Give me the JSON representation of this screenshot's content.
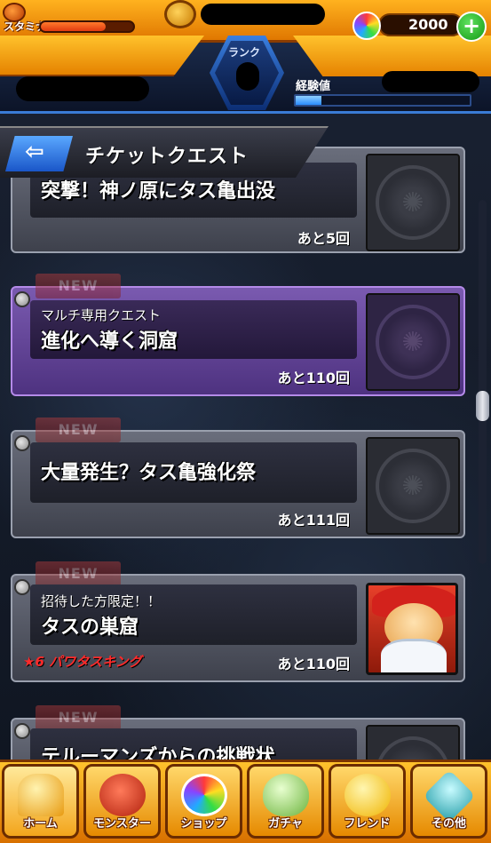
{
  "header": {
    "stamina_label": "スタミナ",
    "stamina_fill_fraction": 0.7,
    "orb_count": "2000",
    "add_orb_symbol": "+",
    "rank_label": "ランク",
    "exp_label": "経験値",
    "exp_fill_fraction": 0.15
  },
  "titlebar": {
    "back_symbol": "⇦",
    "title": "チケットクエスト"
  },
  "quests": [
    {
      "new_tag": "",
      "subtitle": "",
      "title": "突撃！神ノ原にタス亀出没",
      "remaining": "あと5回",
      "reward": "",
      "theme": "gray",
      "thumb": "dragon-emblem-icon"
    },
    {
      "new_tag": "NEW",
      "subtitle": "マルチ専用クエスト",
      "title": "進化へ導く洞窟",
      "remaining": "あと110回",
      "reward": "",
      "theme": "purple",
      "thumb": "dragon-emblem-icon"
    },
    {
      "new_tag": "NEW",
      "subtitle": "",
      "title": "大量発生？タス亀強化祭",
      "remaining": "あと111回",
      "reward": "",
      "theme": "gray",
      "thumb": "dragon-emblem-icon"
    },
    {
      "new_tag": "NEW",
      "subtitle": "招待した方限定！！",
      "title": "タスの巣窟",
      "remaining": "あと110回",
      "reward": "★6 パワタスキング",
      "theme": "gray",
      "thumb": "monster-portrait"
    },
    {
      "new_tag": "NEW",
      "subtitle": "",
      "title": "テルーマンズからの挑戦状",
      "remaining": "",
      "reward": "",
      "theme": "gray",
      "thumb": "dragon-emblem-icon"
    }
  ],
  "bottom_nav": [
    {
      "label": "ホーム",
      "icon": "home-icon",
      "color": "#f3a51c"
    },
    {
      "label": "モンスター",
      "icon": "monster-icon",
      "color": "#e8402a"
    },
    {
      "label": "ショップ",
      "icon": "orb-icon",
      "color": "#8844ff"
    },
    {
      "label": "ガチャ",
      "icon": "egg-icon",
      "color": "#8ad05a"
    },
    {
      "label": "フレンド",
      "icon": "friends-icon",
      "color": "#ffcf33"
    },
    {
      "label": "その他",
      "icon": "other-icon",
      "color": "#38b7c0"
    }
  ],
  "colors": {
    "accent_orange": "#f39a1c",
    "accent_blue": "#3a7bd5",
    "reward_red": "#ff2a2a"
  }
}
